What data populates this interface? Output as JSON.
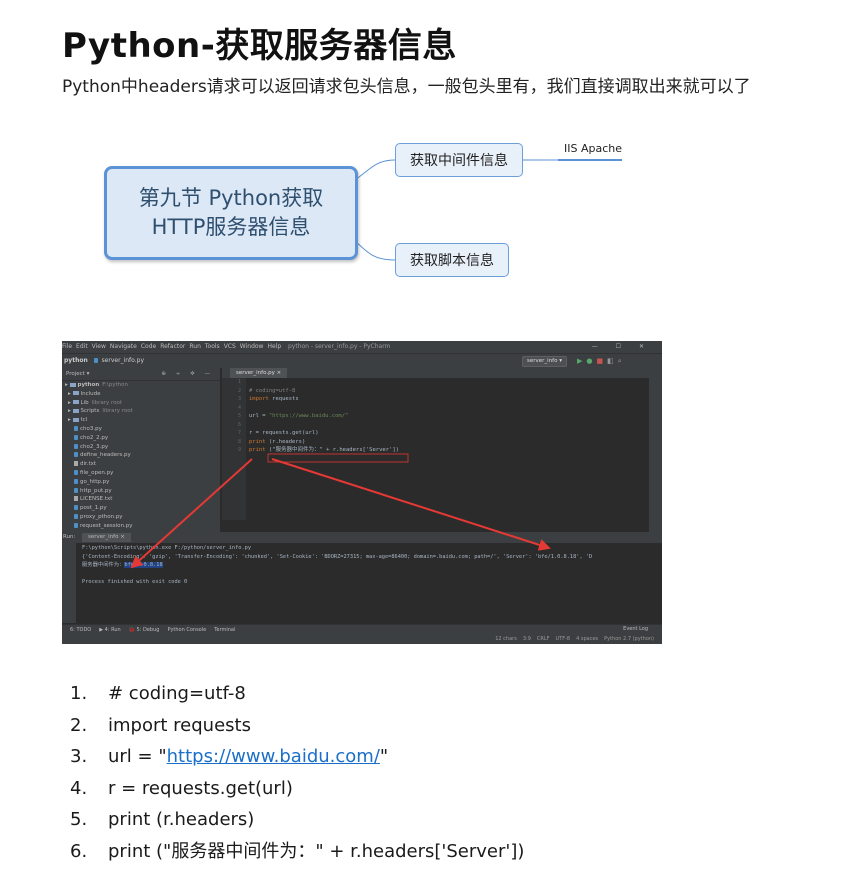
{
  "article": {
    "title": "Python-获取服务器信息",
    "intro": "Python中headers请求可以返回请求包头信息，一般包头里有，我们直接调取出来就可以了"
  },
  "mindmap": {
    "main_line1": "第九节 Python获取",
    "main_line2": "HTTP服务器信息",
    "node_middleware": "获取中间件信息",
    "node_script": "获取脚本信息",
    "leaf_middleware": "IIS Apache",
    "colors": {
      "border": "#5b93d6",
      "fill": "#dce8f6",
      "line": "#5b93d6"
    }
  },
  "ide": {
    "menu": [
      "File",
      "Edit",
      "View",
      "Navigate",
      "Code",
      "Refactor",
      "Run",
      "Tools",
      "VCS",
      "Window",
      "Help"
    ],
    "window_title": "python - server_info.py - PyCharm",
    "window_buttons": "—  ☐  ✕",
    "nav_project": "python",
    "nav_file": "server_info.py",
    "run_config": "server_info ▾",
    "project_label": "Project ▾",
    "project_tools": "⊕ ÷ ✲ —",
    "tree": [
      {
        "type": "folder",
        "name": "python",
        "extra": "F:\\python",
        "bold": true
      },
      {
        "type": "folder",
        "name": "Include",
        "extra": ""
      },
      {
        "type": "folder",
        "name": "Lib",
        "extra": "library root"
      },
      {
        "type": "folder",
        "name": "Scripts",
        "extra": "library root"
      },
      {
        "type": "folder",
        "name": "tcl",
        "extra": ""
      },
      {
        "type": "py",
        "name": "cho3.py",
        "extra": ""
      },
      {
        "type": "py",
        "name": "cho2_2.py",
        "extra": ""
      },
      {
        "type": "py",
        "name": "cho2_3.py",
        "extra": ""
      },
      {
        "type": "py",
        "name": "define_headers.py",
        "extra": ""
      },
      {
        "type": "txt",
        "name": "dir.txt",
        "extra": ""
      },
      {
        "type": "py",
        "name": "file_open.py",
        "extra": ""
      },
      {
        "type": "py",
        "name": "go_http.py",
        "extra": ""
      },
      {
        "type": "py",
        "name": "http_put.py",
        "extra": ""
      },
      {
        "type": "txt",
        "name": "LICENSE.txt",
        "extra": ""
      },
      {
        "type": "py",
        "name": "post_1.py",
        "extra": ""
      },
      {
        "type": "py",
        "name": "proxy_pthon.py",
        "extra": ""
      },
      {
        "type": "py",
        "name": "request_session.py",
        "extra": ""
      }
    ],
    "editor_tab": "server_info.py ×",
    "line_numbers": [
      "1",
      "2",
      "3",
      "4",
      "5",
      "6",
      "7",
      "8",
      "9"
    ],
    "code_lines": {
      "l2": "# coding=utf-8",
      "l3_kw": "import",
      "l3_rest": " requests",
      "l5_pre": "url = ",
      "l5_str": "\"https://www.baidu.com/\"",
      "l7": "r = requests.get(url)",
      "l8_kw": "print",
      "l8_rest": " (r.headers)",
      "l9_kw": "print",
      "l9_rest": " (\"服务器中间件为：\" + r.headers['Server'])"
    },
    "run_tab": "server_info ×",
    "run_label": "Run:",
    "console": {
      "l1": "F:\\python\\Scripts\\python.exe F:/python/server_info.py",
      "l2": "{'Content-Encoding': 'gzip', 'Transfer-Encoding': 'chunked', 'Set-Cookie': 'BDORZ=27315; max-age=86400; domain=.baidu.com; path=/', 'Server': 'bfe/1.0.8.18', 'D",
      "l3_pre": "服务器中间件为：",
      "l3_sel": "bfe/1.0.8.18",
      "l5": "Process finished with exit code 0"
    },
    "bottom_tabs": [
      "6: TODO",
      "▶ 4: Run",
      "🐞 5: Debug",
      "Python Console",
      "Terminal"
    ],
    "event_log": "Event Log",
    "status": [
      "12 chars",
      "3:9",
      "CRLF",
      "UTF-8",
      "4 spaces",
      "Python 2.7 (python)"
    ],
    "arrow_color": "#e53935"
  },
  "code_listing": [
    {
      "num": "1.",
      "text": "# coding=utf-8"
    },
    {
      "num": "2.",
      "text": "import requests"
    },
    {
      "num": "3.",
      "pre": "url = \"",
      "link": "https://www.baidu.com/",
      "post": "\""
    },
    {
      "num": "4.",
      "text": "r = requests.get(url)"
    },
    {
      "num": "5.",
      "text": "print (r.headers)"
    },
    {
      "num": "6.",
      "text": "print (\"服务器中间件为：\" + r.headers['Server'])"
    }
  ]
}
